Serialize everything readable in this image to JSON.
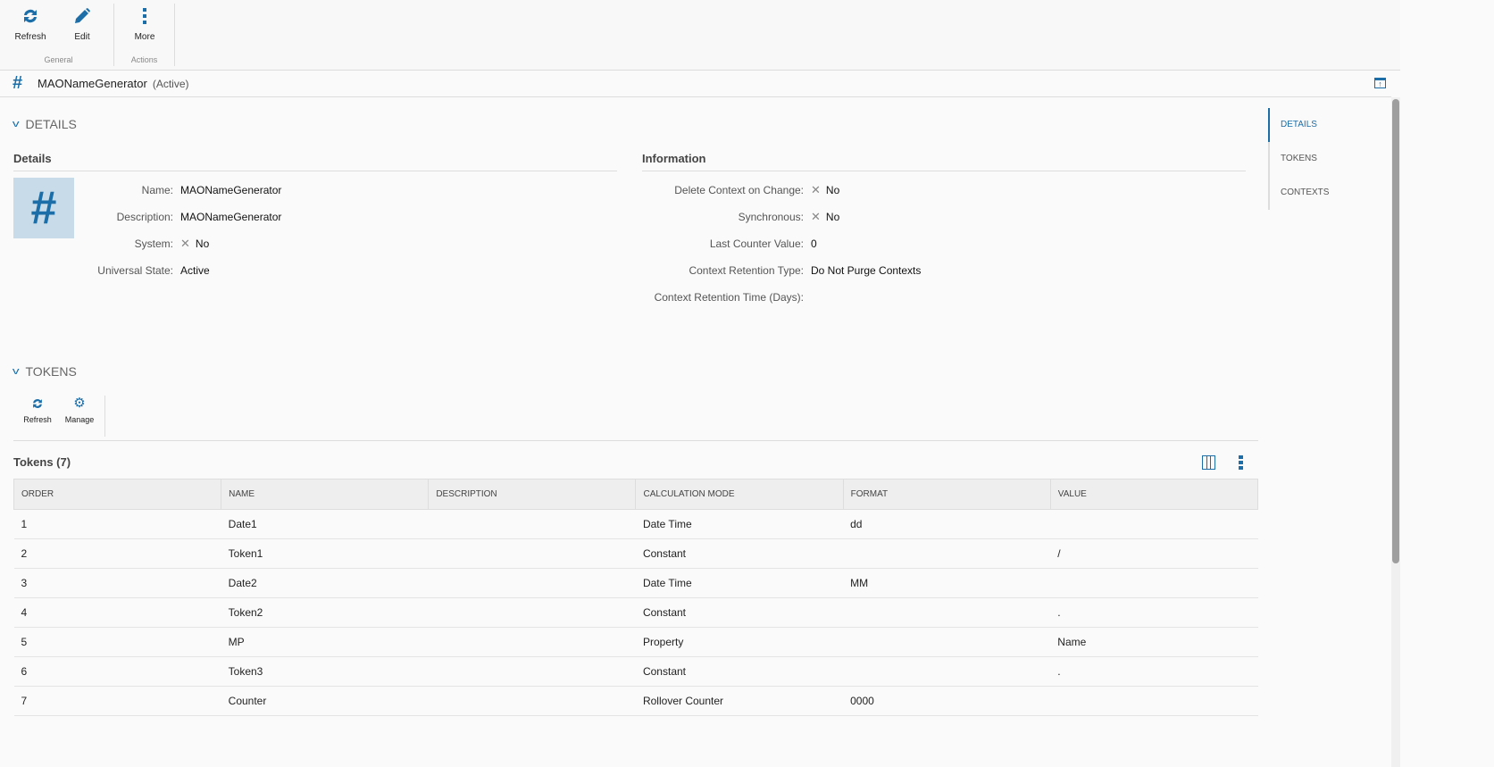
{
  "toolbar": {
    "refresh": "Refresh",
    "edit": "Edit",
    "more": "More",
    "group_general": "General",
    "group_actions": "Actions"
  },
  "title": {
    "name": "MAONameGenerator",
    "state": "(Active)"
  },
  "sections": {
    "details": "DETAILS",
    "tokens": "TOKENS"
  },
  "details": {
    "heading": "Details",
    "fields": [
      {
        "label": "Name:",
        "value": "MAONameGenerator"
      },
      {
        "label": "Description:",
        "value": "MAONameGenerator"
      },
      {
        "label": "System:",
        "value": "No"
      },
      {
        "label": "Universal State:",
        "value": "Active"
      }
    ]
  },
  "information": {
    "heading": "Information",
    "fields": [
      {
        "label": "Delete Context on Change:",
        "value": "No"
      },
      {
        "label": "Synchronous:",
        "value": "No"
      },
      {
        "label": "Last Counter Value:",
        "value": "0"
      },
      {
        "label": "Context Retention Type:",
        "value": "Do Not Purge Contexts"
      },
      {
        "label": "Context Retention Time (Days):",
        "value": ""
      }
    ]
  },
  "rightnav": [
    "DETAILS",
    "TOKENS",
    "CONTEXTS"
  ],
  "tokens_toolbar": {
    "refresh": "Refresh",
    "manage": "Manage"
  },
  "tokens_table": {
    "title": "Tokens (7)",
    "columns": [
      "ORDER",
      "NAME",
      "DESCRIPTION",
      "CALCULATION MODE",
      "FORMAT",
      "VALUE"
    ],
    "rows": [
      [
        "1",
        "Date1",
        "",
        "Date Time",
        "dd",
        ""
      ],
      [
        "2",
        "Token1",
        "",
        "Constant",
        "",
        "/"
      ],
      [
        "3",
        "Date2",
        "",
        "Date Time",
        "MM",
        ""
      ],
      [
        "4",
        "Token2",
        "",
        "Constant",
        "",
        "."
      ],
      [
        "5",
        "MP",
        "",
        "Property",
        "",
        "Name"
      ],
      [
        "6",
        "Token3",
        "",
        "Constant",
        "",
        "."
      ],
      [
        "7",
        "Counter",
        "",
        "Rollover Counter",
        "0000",
        ""
      ]
    ]
  }
}
